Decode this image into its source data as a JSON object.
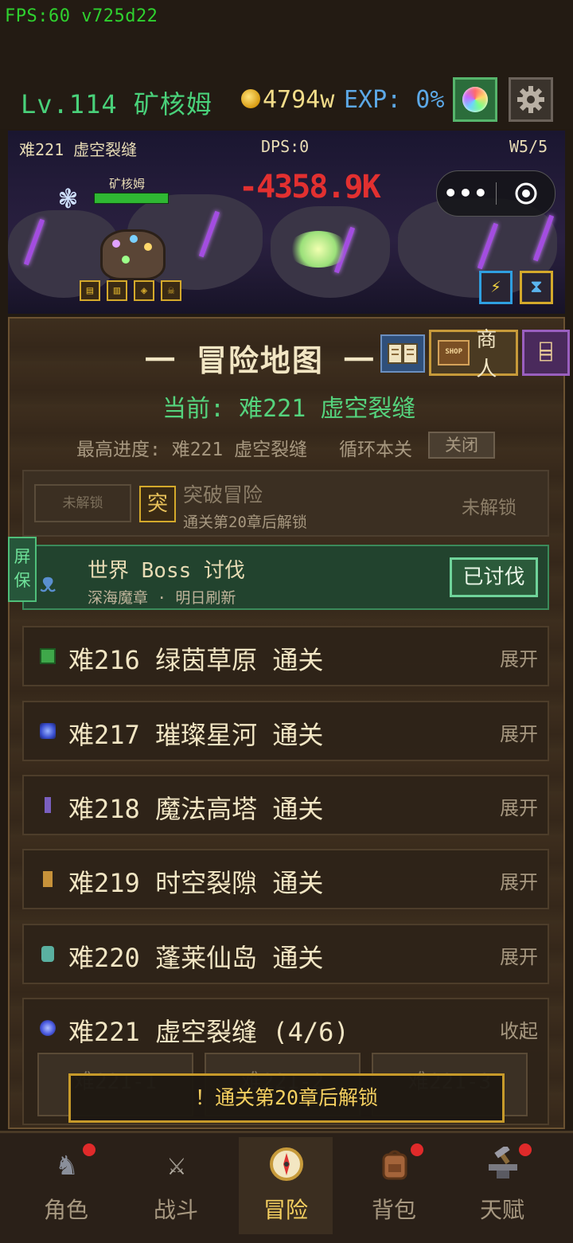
{
  "topbar": {
    "fps": "FPS:60 v725d22",
    "level": "Lv.114 矿核姆",
    "gold": "4794w",
    "exp": "EXP: 0%"
  },
  "battle": {
    "stage": "难221 虚空裂缝",
    "dps": "DPS:0",
    "wave": "W5/5",
    "hero_name": "矿核姆",
    "damage": "-4358.9K",
    "hero_hp_fraction": 1.0
  },
  "map": {
    "title": "一 冒险地图 一",
    "shop_sign": "SHOP",
    "shop_label": "商人",
    "current": "当前: 难221 虚空裂缝",
    "best": "最高进度: 难221 虚空裂缝",
    "loop_label": "循环本关",
    "loop_button": "关闭",
    "breakthrough": {
      "lock_button": "未解锁",
      "icon_char": "突",
      "title": "突破冒险",
      "subtitle": "通关第20章后解锁",
      "status": "未解锁"
    },
    "screensaver": "屏保",
    "world_boss": {
      "title": "世界 Boss 讨伐",
      "subtitle": "深海魔章 · 明日刷新",
      "button": "已讨伐"
    },
    "stages": [
      {
        "name": "难216 绿茵草原 通关",
        "toggle": "展开",
        "icon_color": "#3fa84a"
      },
      {
        "name": "难217 璀璨星河 通关",
        "toggle": "展开",
        "icon_color": "#3a4fd0"
      },
      {
        "name": "难218 魔法高塔 通关",
        "toggle": "展开",
        "icon_color": "#7a5fbf"
      },
      {
        "name": "难219 时空裂隙 通关",
        "toggle": "展开",
        "icon_color": "#c7923a"
      },
      {
        "name": "难220 蓬莱仙岛 通关",
        "toggle": "展开",
        "icon_color": "#5ab0a0"
      },
      {
        "name": "难221 虚空裂缝 (4/6)",
        "toggle": "收起",
        "icon_color": "#4a5ae0"
      }
    ],
    "sub_stages": [
      "难221-1",
      "难221-2",
      "难221-3"
    ],
    "toast": "！通关第20章后解锁"
  },
  "nav": [
    {
      "label": "角色",
      "icon": "knight-icon",
      "badge": true
    },
    {
      "label": "战斗",
      "icon": "sword-icon",
      "badge": false
    },
    {
      "label": "冒险",
      "icon": "compass-icon",
      "badge": false,
      "active": true
    },
    {
      "label": "背包",
      "icon": "backpack-icon",
      "badge": true
    },
    {
      "label": "天赋",
      "icon": "anvil-icon",
      "badge": true
    }
  ]
}
